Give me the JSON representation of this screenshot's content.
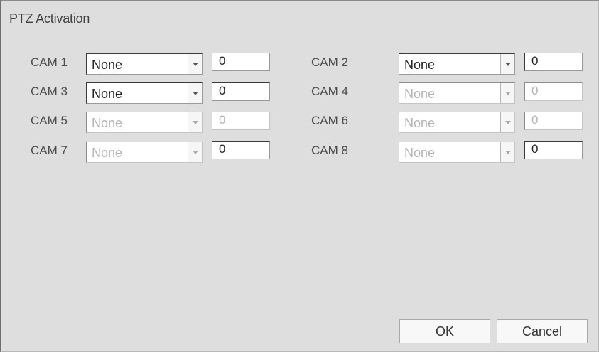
{
  "dialog": {
    "title": "PTZ Activation"
  },
  "cameras": [
    {
      "label": "CAM 1",
      "select_value": "None",
      "number": "0",
      "enabled": true
    },
    {
      "label": "CAM 2",
      "select_value": "None",
      "number": "0",
      "enabled": true
    },
    {
      "label": "CAM 3",
      "select_value": "None",
      "number": "0",
      "enabled": true
    },
    {
      "label": "CAM 4",
      "select_value": "None",
      "number": "0",
      "enabled": false
    },
    {
      "label": "CAM 5",
      "select_value": "None",
      "number": "0",
      "enabled": false
    },
    {
      "label": "CAM 6",
      "select_value": "None",
      "number": "0",
      "enabled": false
    },
    {
      "label": "CAM 7",
      "select_value": "None",
      "number": "0",
      "enabled": false
    },
    {
      "label": "CAM 8",
      "select_value": "None",
      "number": "0",
      "enabled": false
    }
  ],
  "buttons": {
    "ok_label": "OK",
    "cancel_label": "Cancel"
  }
}
